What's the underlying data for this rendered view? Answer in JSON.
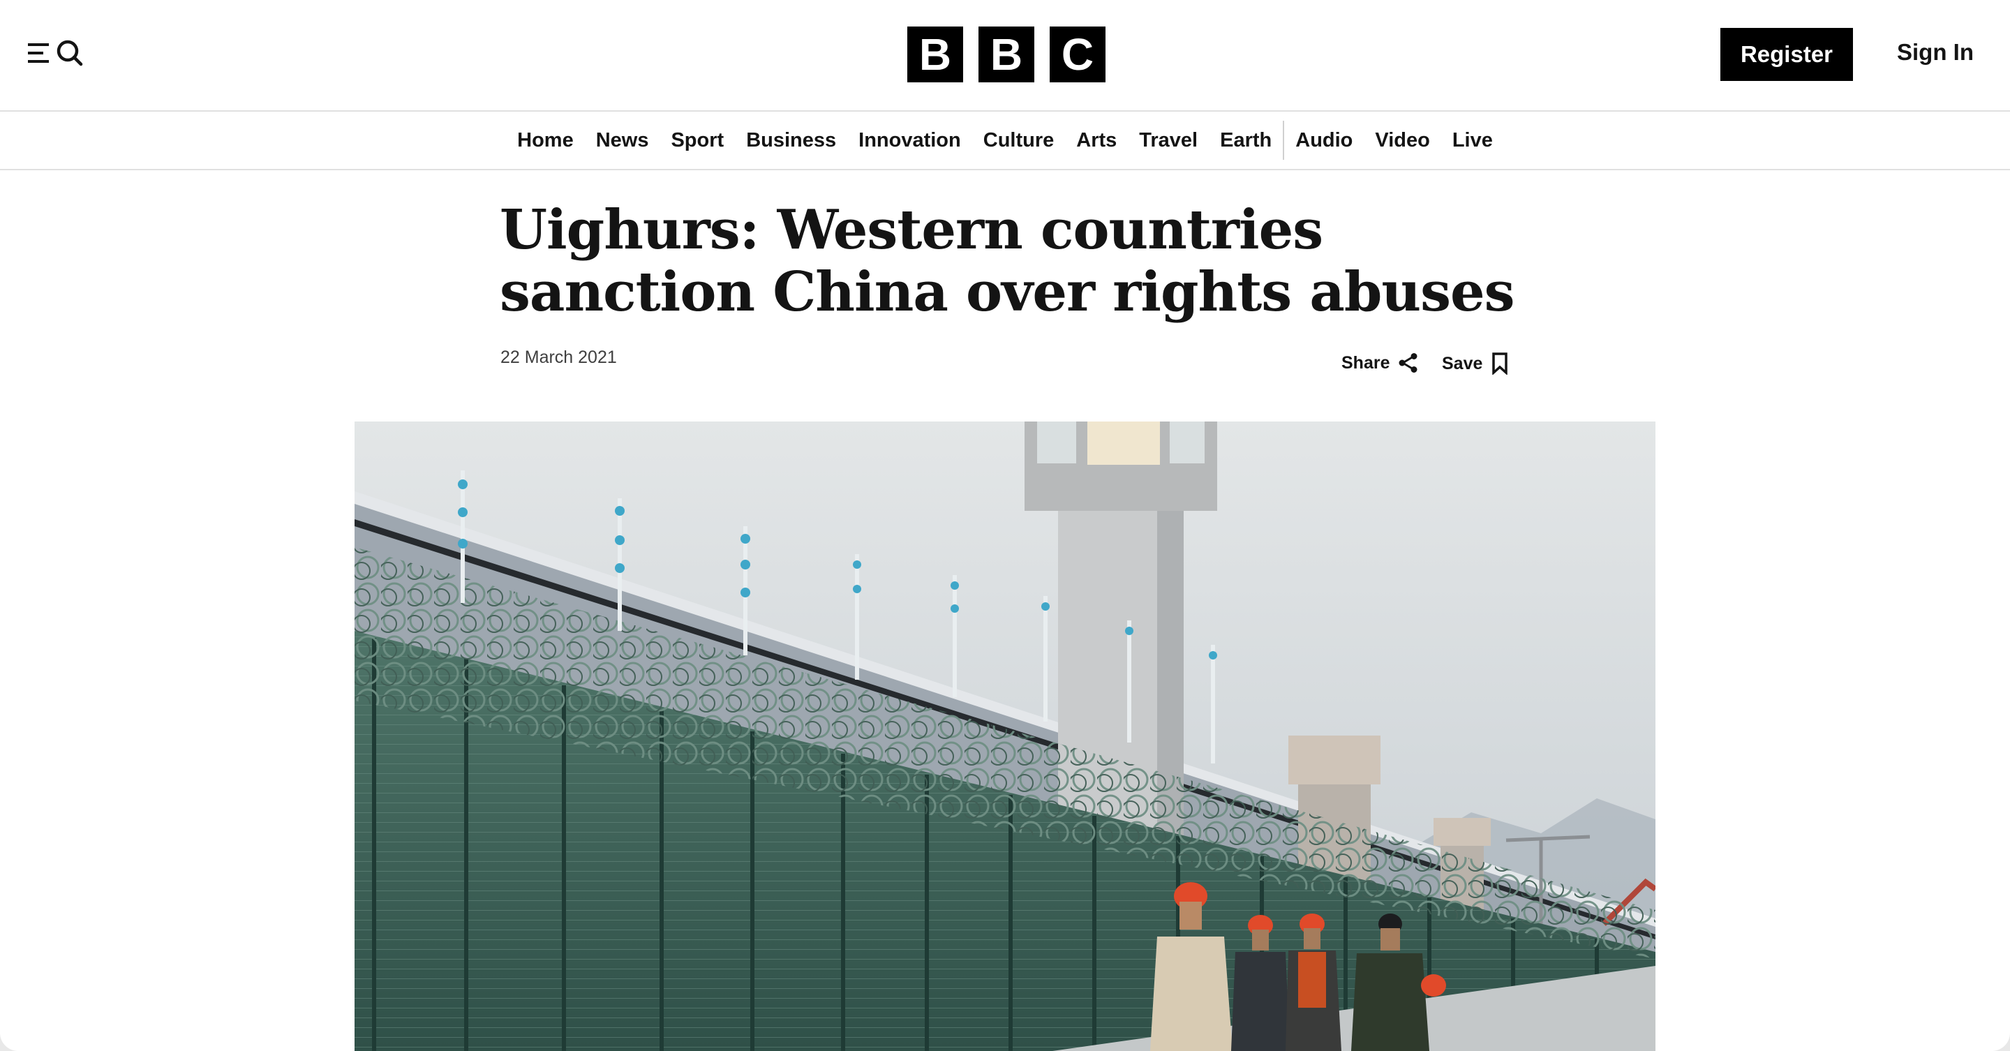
{
  "header": {
    "logo_letters": [
      "B",
      "B",
      "C"
    ],
    "register_label": "Register",
    "signin_label": "Sign In",
    "menu_icons": [
      "menu-icon",
      "search-icon"
    ]
  },
  "nav": {
    "items": [
      "Home",
      "News",
      "Sport",
      "Business",
      "Innovation",
      "Culture",
      "Arts",
      "Travel",
      "Earth",
      "Audio",
      "Video",
      "Live"
    ]
  },
  "article": {
    "headline": "Uighurs: Western countries sanction China over rights abuses",
    "date": "22 March 2021",
    "share_label": "Share",
    "save_label": "Save",
    "share_icon": "share-icon",
    "save_icon": "bookmark-icon"
  },
  "hero": {
    "subject": "photo"
  },
  "colors": {
    "text": "#141414",
    "button_bg": "#000000",
    "button_text": "#ffffff",
    "divider": "#e0e0e0"
  }
}
